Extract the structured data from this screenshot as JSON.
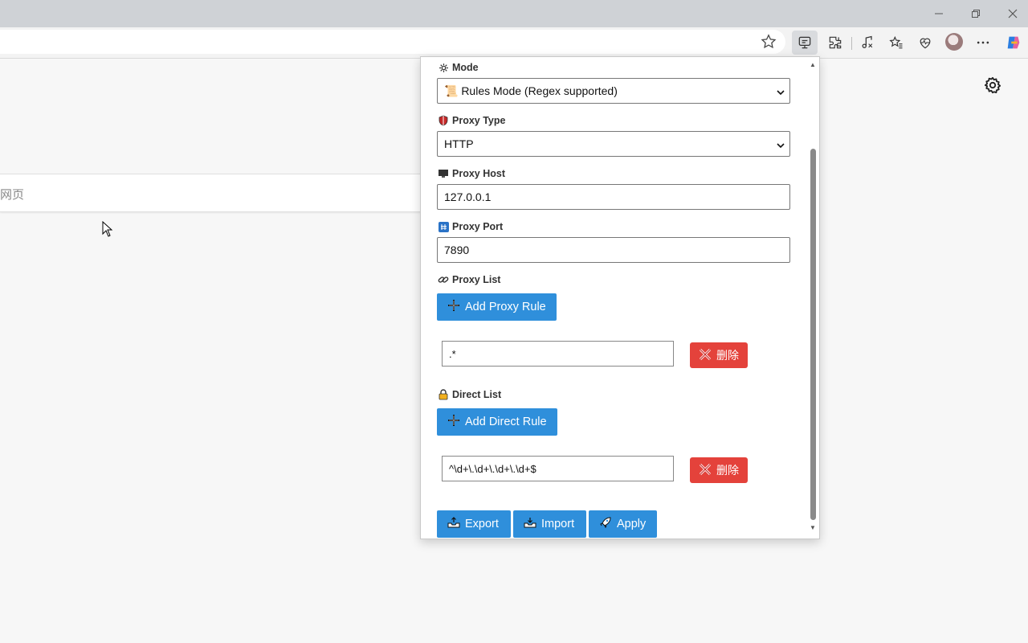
{
  "browser": {
    "address_placeholder": "",
    "page_search_hint": "网页"
  },
  "popup": {
    "mode": {
      "label": "Mode",
      "value": "📜 Rules Mode (Regex supported)"
    },
    "proxy_type": {
      "label": "Proxy Type",
      "value": "HTTP"
    },
    "proxy_host": {
      "label": "Proxy Host",
      "value": "127.0.0.1"
    },
    "proxy_port": {
      "label": "Proxy Port",
      "value": "7890"
    },
    "proxy_list": {
      "label": "Proxy List",
      "add_label": "Add Proxy Rule",
      "rules": [
        {
          "value": ".*",
          "delete_label": "删除"
        }
      ]
    },
    "direct_list": {
      "label": "Direct List",
      "add_label": "Add Direct Rule",
      "rules": [
        {
          "value": "^\\d+\\.\\d+\\.\\d+\\.\\d+$",
          "delete_label": "删除"
        }
      ]
    },
    "actions": {
      "export_label": "Export",
      "import_label": "Import",
      "apply_label": "Apply"
    }
  },
  "colors": {
    "accent_blue": "#2f8fdb",
    "danger_red": "#e4423b"
  }
}
